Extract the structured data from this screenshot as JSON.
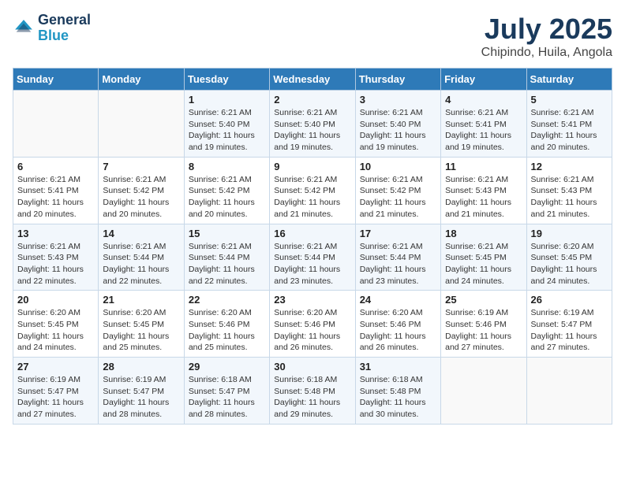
{
  "header": {
    "logo_line1": "General",
    "logo_line2": "Blue",
    "month": "July 2025",
    "location": "Chipindo, Huila, Angola"
  },
  "columns": [
    "Sunday",
    "Monday",
    "Tuesday",
    "Wednesday",
    "Thursday",
    "Friday",
    "Saturday"
  ],
  "weeks": [
    [
      {
        "day": "",
        "sunrise": "",
        "sunset": "",
        "daylight": ""
      },
      {
        "day": "",
        "sunrise": "",
        "sunset": "",
        "daylight": ""
      },
      {
        "day": "1",
        "sunrise": "Sunrise: 6:21 AM",
        "sunset": "Sunset: 5:40 PM",
        "daylight": "Daylight: 11 hours and 19 minutes."
      },
      {
        "day": "2",
        "sunrise": "Sunrise: 6:21 AM",
        "sunset": "Sunset: 5:40 PM",
        "daylight": "Daylight: 11 hours and 19 minutes."
      },
      {
        "day": "3",
        "sunrise": "Sunrise: 6:21 AM",
        "sunset": "Sunset: 5:40 PM",
        "daylight": "Daylight: 11 hours and 19 minutes."
      },
      {
        "day": "4",
        "sunrise": "Sunrise: 6:21 AM",
        "sunset": "Sunset: 5:41 PM",
        "daylight": "Daylight: 11 hours and 19 minutes."
      },
      {
        "day": "5",
        "sunrise": "Sunrise: 6:21 AM",
        "sunset": "Sunset: 5:41 PM",
        "daylight": "Daylight: 11 hours and 20 minutes."
      }
    ],
    [
      {
        "day": "6",
        "sunrise": "Sunrise: 6:21 AM",
        "sunset": "Sunset: 5:41 PM",
        "daylight": "Daylight: 11 hours and 20 minutes."
      },
      {
        "day": "7",
        "sunrise": "Sunrise: 6:21 AM",
        "sunset": "Sunset: 5:42 PM",
        "daylight": "Daylight: 11 hours and 20 minutes."
      },
      {
        "day": "8",
        "sunrise": "Sunrise: 6:21 AM",
        "sunset": "Sunset: 5:42 PM",
        "daylight": "Daylight: 11 hours and 20 minutes."
      },
      {
        "day": "9",
        "sunrise": "Sunrise: 6:21 AM",
        "sunset": "Sunset: 5:42 PM",
        "daylight": "Daylight: 11 hours and 21 minutes."
      },
      {
        "day": "10",
        "sunrise": "Sunrise: 6:21 AM",
        "sunset": "Sunset: 5:42 PM",
        "daylight": "Daylight: 11 hours and 21 minutes."
      },
      {
        "day": "11",
        "sunrise": "Sunrise: 6:21 AM",
        "sunset": "Sunset: 5:43 PM",
        "daylight": "Daylight: 11 hours and 21 minutes."
      },
      {
        "day": "12",
        "sunrise": "Sunrise: 6:21 AM",
        "sunset": "Sunset: 5:43 PM",
        "daylight": "Daylight: 11 hours and 21 minutes."
      }
    ],
    [
      {
        "day": "13",
        "sunrise": "Sunrise: 6:21 AM",
        "sunset": "Sunset: 5:43 PM",
        "daylight": "Daylight: 11 hours and 22 minutes."
      },
      {
        "day": "14",
        "sunrise": "Sunrise: 6:21 AM",
        "sunset": "Sunset: 5:44 PM",
        "daylight": "Daylight: 11 hours and 22 minutes."
      },
      {
        "day": "15",
        "sunrise": "Sunrise: 6:21 AM",
        "sunset": "Sunset: 5:44 PM",
        "daylight": "Daylight: 11 hours and 22 minutes."
      },
      {
        "day": "16",
        "sunrise": "Sunrise: 6:21 AM",
        "sunset": "Sunset: 5:44 PM",
        "daylight": "Daylight: 11 hours and 23 minutes."
      },
      {
        "day": "17",
        "sunrise": "Sunrise: 6:21 AM",
        "sunset": "Sunset: 5:44 PM",
        "daylight": "Daylight: 11 hours and 23 minutes."
      },
      {
        "day": "18",
        "sunrise": "Sunrise: 6:21 AM",
        "sunset": "Sunset: 5:45 PM",
        "daylight": "Daylight: 11 hours and 24 minutes."
      },
      {
        "day": "19",
        "sunrise": "Sunrise: 6:20 AM",
        "sunset": "Sunset: 5:45 PM",
        "daylight": "Daylight: 11 hours and 24 minutes."
      }
    ],
    [
      {
        "day": "20",
        "sunrise": "Sunrise: 6:20 AM",
        "sunset": "Sunset: 5:45 PM",
        "daylight": "Daylight: 11 hours and 24 minutes."
      },
      {
        "day": "21",
        "sunrise": "Sunrise: 6:20 AM",
        "sunset": "Sunset: 5:45 PM",
        "daylight": "Daylight: 11 hours and 25 minutes."
      },
      {
        "day": "22",
        "sunrise": "Sunrise: 6:20 AM",
        "sunset": "Sunset: 5:46 PM",
        "daylight": "Daylight: 11 hours and 25 minutes."
      },
      {
        "day": "23",
        "sunrise": "Sunrise: 6:20 AM",
        "sunset": "Sunset: 5:46 PM",
        "daylight": "Daylight: 11 hours and 26 minutes."
      },
      {
        "day": "24",
        "sunrise": "Sunrise: 6:20 AM",
        "sunset": "Sunset: 5:46 PM",
        "daylight": "Daylight: 11 hours and 26 minutes."
      },
      {
        "day": "25",
        "sunrise": "Sunrise: 6:19 AM",
        "sunset": "Sunset: 5:46 PM",
        "daylight": "Daylight: 11 hours and 27 minutes."
      },
      {
        "day": "26",
        "sunrise": "Sunrise: 6:19 AM",
        "sunset": "Sunset: 5:47 PM",
        "daylight": "Daylight: 11 hours and 27 minutes."
      }
    ],
    [
      {
        "day": "27",
        "sunrise": "Sunrise: 6:19 AM",
        "sunset": "Sunset: 5:47 PM",
        "daylight": "Daylight: 11 hours and 27 minutes."
      },
      {
        "day": "28",
        "sunrise": "Sunrise: 6:19 AM",
        "sunset": "Sunset: 5:47 PM",
        "daylight": "Daylight: 11 hours and 28 minutes."
      },
      {
        "day": "29",
        "sunrise": "Sunrise: 6:18 AM",
        "sunset": "Sunset: 5:47 PM",
        "daylight": "Daylight: 11 hours and 28 minutes."
      },
      {
        "day": "30",
        "sunrise": "Sunrise: 6:18 AM",
        "sunset": "Sunset: 5:48 PM",
        "daylight": "Daylight: 11 hours and 29 minutes."
      },
      {
        "day": "31",
        "sunrise": "Sunrise: 6:18 AM",
        "sunset": "Sunset: 5:48 PM",
        "daylight": "Daylight: 11 hours and 30 minutes."
      },
      {
        "day": "",
        "sunrise": "",
        "sunset": "",
        "daylight": ""
      },
      {
        "day": "",
        "sunrise": "",
        "sunset": "",
        "daylight": ""
      }
    ]
  ]
}
